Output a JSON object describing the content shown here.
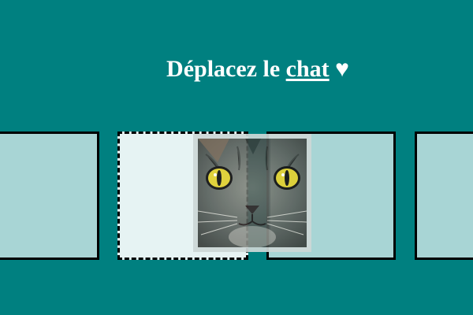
{
  "header": {
    "title_prefix": "Déplacez le ",
    "title_link": "chat",
    "title_suffix": " ♥"
  },
  "slots": [
    {
      "state": "filled"
    },
    {
      "state": "target-dashed"
    },
    {
      "state": "filled"
    },
    {
      "state": "filled"
    }
  ],
  "draggable": {
    "icon": "cat-face-image"
  },
  "colors": {
    "background": "#008080",
    "slot": "#a8d5d5",
    "target_slot": "#e6f3f3",
    "eye": "#e0d030"
  }
}
